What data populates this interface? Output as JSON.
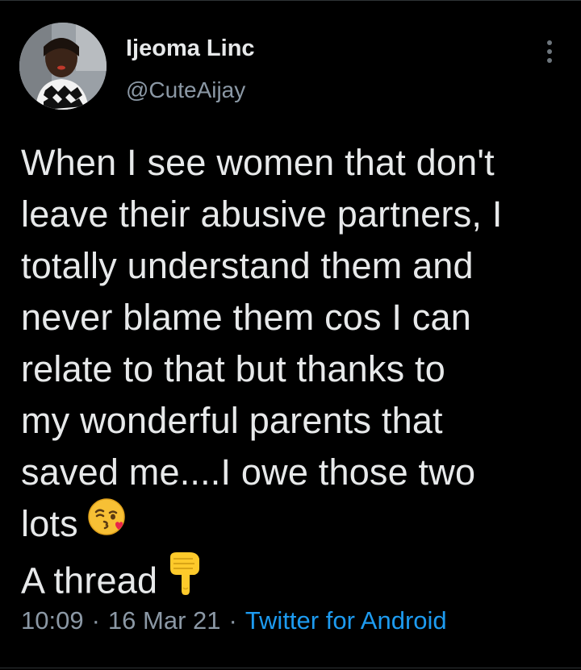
{
  "author": {
    "display_name": "Ijeoma Linc",
    "handle": "@CuteAijay"
  },
  "tweet": {
    "lines": [
      "When I see women that don't",
      "leave their abusive partners, I",
      "totally understand them and",
      "never blame them cos I can",
      "relate to that but thanks to",
      "my wonderful parents that",
      "saved me....I owe those two",
      "lots",
      "A thread"
    ],
    "emojis": [
      "face-blowing-kiss-icon",
      "backhand-pointing-down-icon"
    ]
  },
  "meta": {
    "time": "10:09",
    "separator": "·",
    "date": "16 Mar 21",
    "source": "Twitter for Android"
  },
  "colors": {
    "background": "#000000",
    "text": "#e7e9ea",
    "secondary": "#8b98a5",
    "link": "#1d9bf0"
  }
}
